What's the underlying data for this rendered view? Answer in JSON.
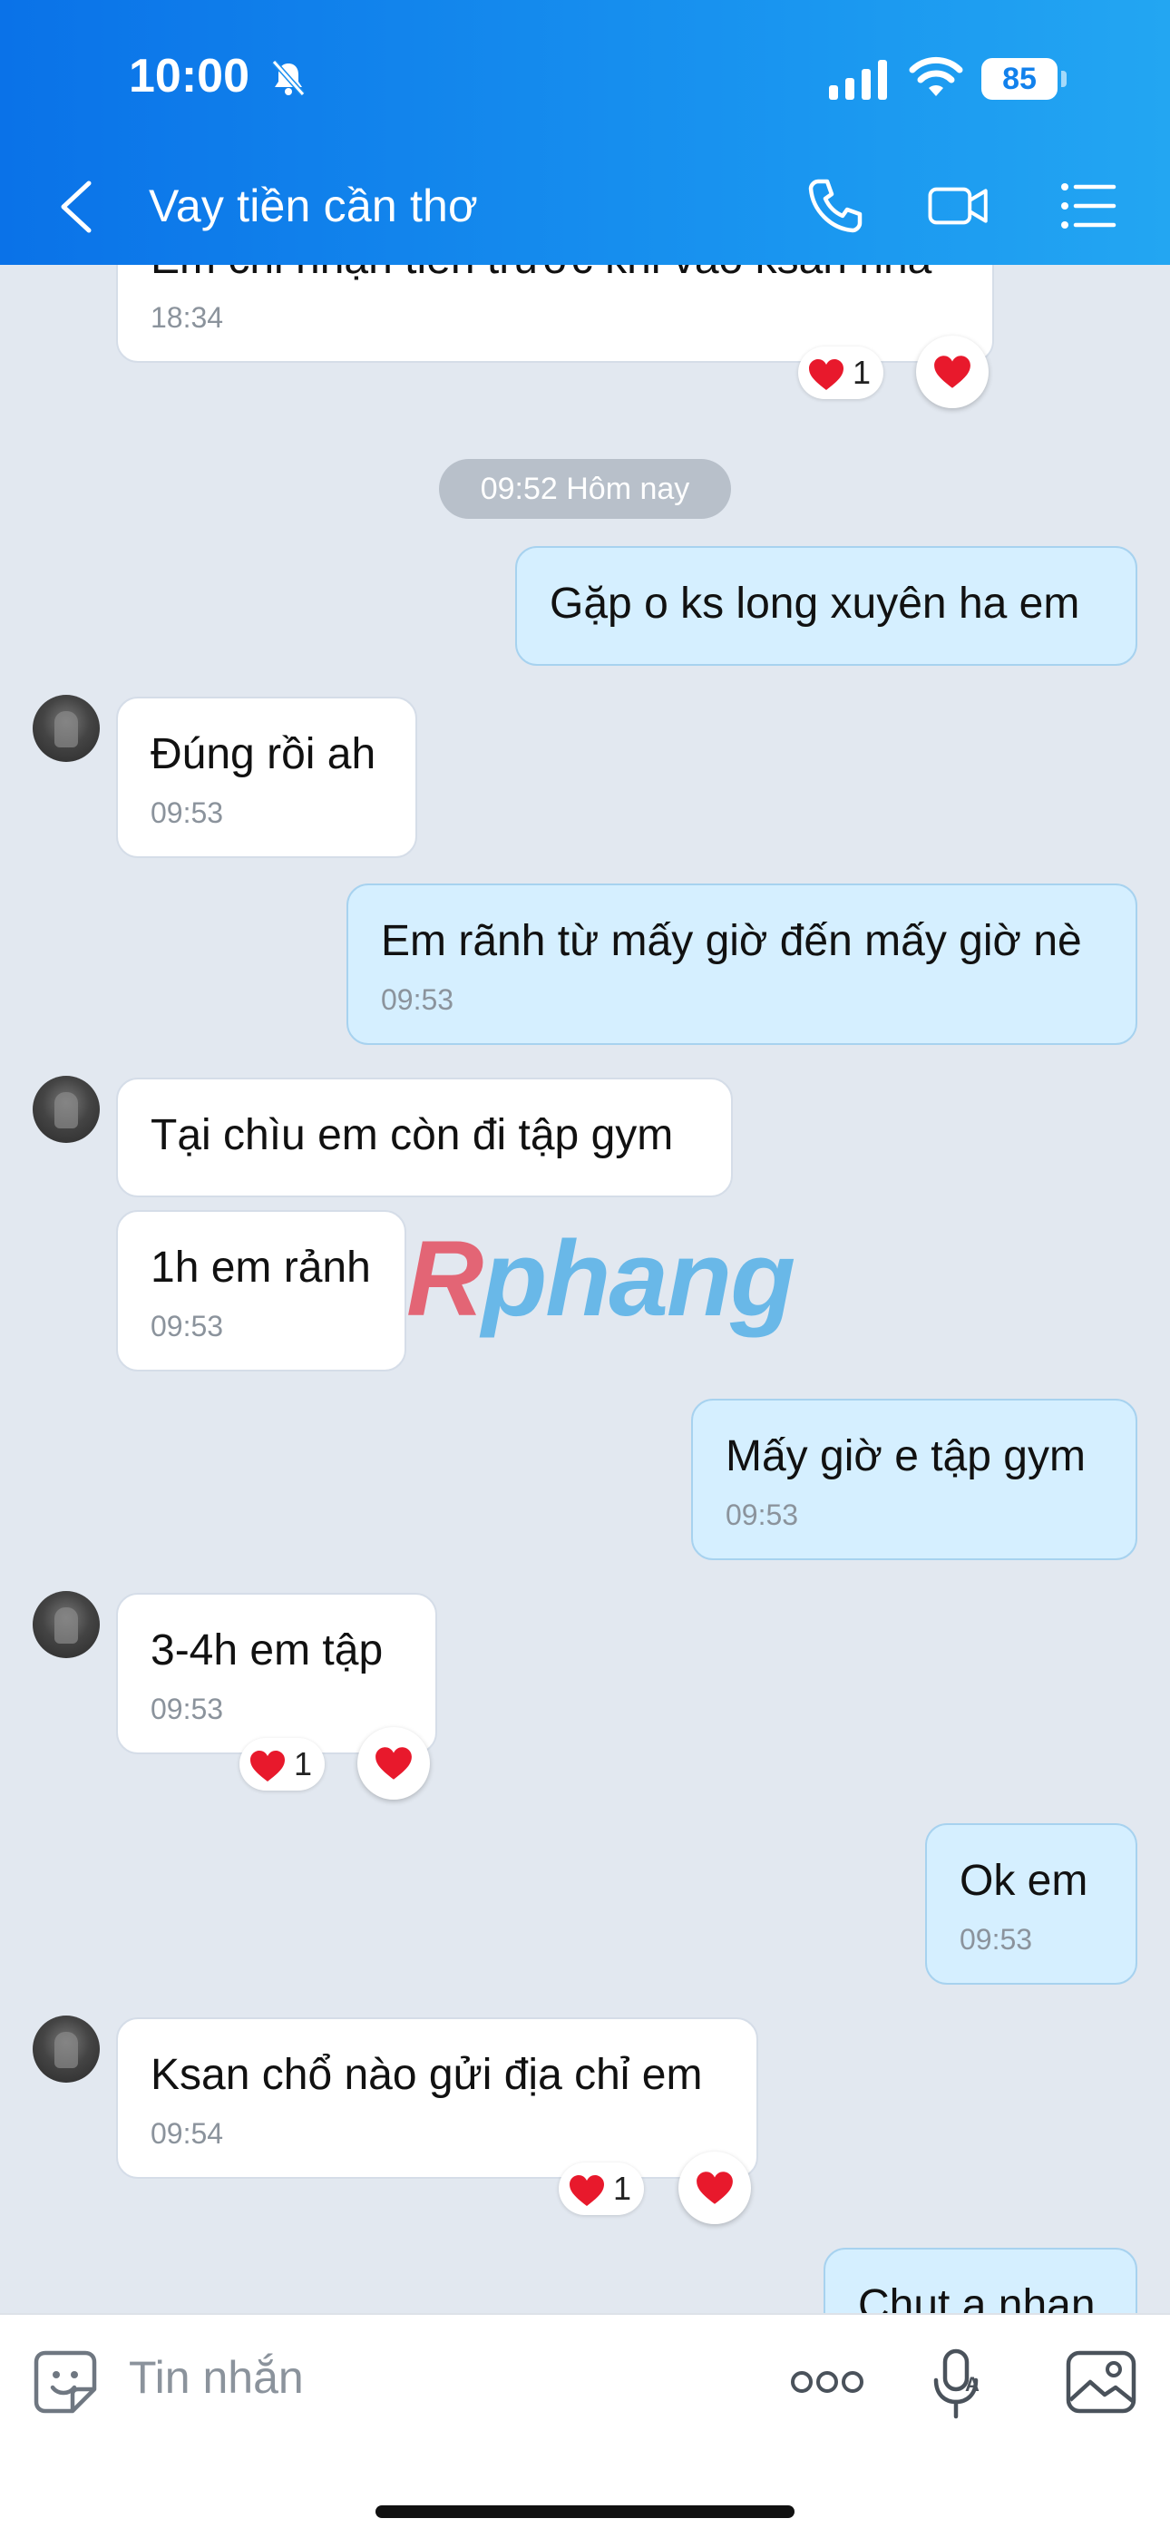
{
  "status_bar": {
    "time": "10:00",
    "battery": "85"
  },
  "header": {
    "title": "Vay tiền cần thơ"
  },
  "messages": [
    {
      "dir": "in",
      "text": "Em chỉ nhận tiền trước khi vào ksan nha",
      "time": "18:34",
      "reaction_count": "1"
    },
    {
      "dir": "chip",
      "text": "09:52 Hôm nay"
    },
    {
      "dir": "out",
      "text": "Gặp o ks long xuyên ha em",
      "time": ""
    },
    {
      "dir": "in",
      "text": "Đúng rồi ah",
      "time": "09:53"
    },
    {
      "dir": "out",
      "text": "Em rãnh từ mấy giờ đến mấy giờ nè",
      "time": "09:53"
    },
    {
      "dir": "in",
      "text": "Tại chìu em còn đi tập gym",
      "time": ""
    },
    {
      "dir": "in",
      "text": "1h em rảnh",
      "time": "09:53"
    },
    {
      "dir": "out",
      "text": "Mấy giờ e tập gym",
      "time": "09:53"
    },
    {
      "dir": "in",
      "text": "3-4h em tập",
      "time": "09:53",
      "reaction_count": "1"
    },
    {
      "dir": "out",
      "text": "Ok em",
      "time": "09:53"
    },
    {
      "dir": "in",
      "text": "Ksan chổ nào gửi địa chỉ em",
      "time": "09:54",
      "reaction_count": "1"
    },
    {
      "dir": "out",
      "text": "Chut a nhan",
      "time": ""
    }
  ],
  "watermark": {
    "first": "R",
    "rest": "phang"
  },
  "input": {
    "placeholder": "Tin nhắn"
  },
  "icons": [
    "back-arrow-icon",
    "phone-icon",
    "video-call-icon",
    "list-menu-icon",
    "sticker-icon",
    "more-icon",
    "voice-to-text-icon",
    "image-icon",
    "heart-icon",
    "bell-muted-icon"
  ]
}
